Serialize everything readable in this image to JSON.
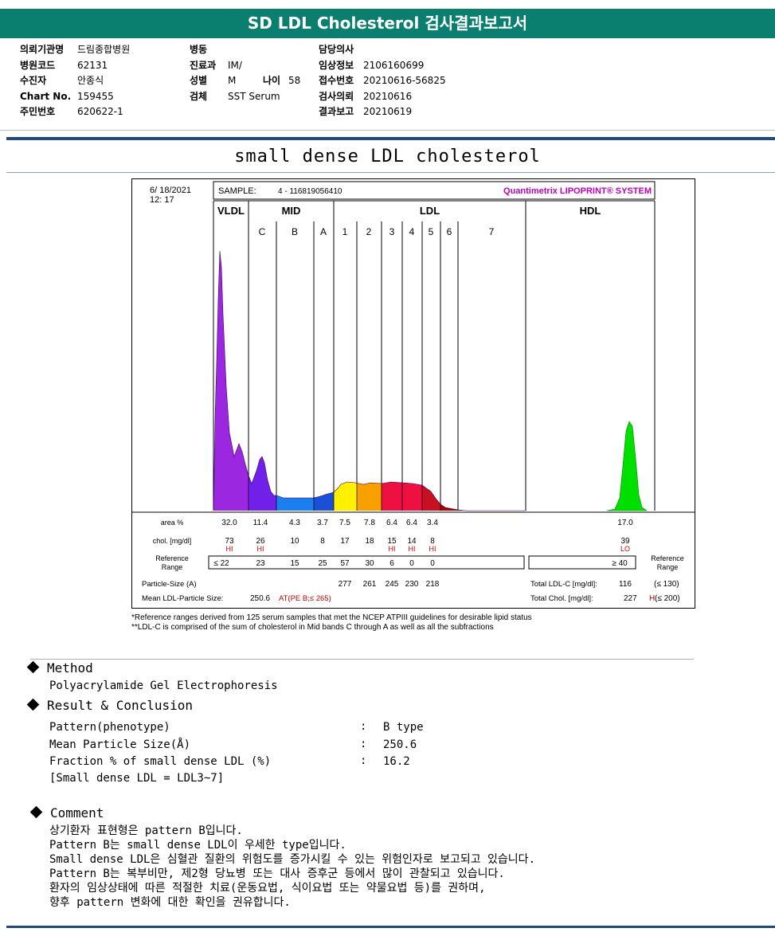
{
  "header": {
    "title": "SD LDL Cholesterol 검사결과보고서"
  },
  "patient_info": {
    "col1": [
      {
        "label": "의뢰기관명",
        "value": "드림종합병원"
      },
      {
        "label": "병원코드",
        "value": "62131"
      },
      {
        "label": "수진자",
        "value": "안종식"
      },
      {
        "label": "Chart No.",
        "value": "159455"
      },
      {
        "label": "주민번호",
        "value": "620622-1"
      }
    ],
    "col2": [
      {
        "label": "병동",
        "value": ""
      },
      {
        "label": "진료과",
        "value": "IM/"
      },
      {
        "label": "성별",
        "value": "M"
      },
      {
        "label": "검체",
        "value": "SST Serum"
      }
    ],
    "age_label": "나이",
    "age_value": "58",
    "col3": [
      {
        "label": "담당의사",
        "value": ""
      },
      {
        "label": "임상정보",
        "value": "2106160699"
      },
      {
        "label": "접수번호",
        "value": "20210616-56825"
      },
      {
        "label": "검사의뢰",
        "value": "20210616"
      },
      {
        "label": "결과보고",
        "value": "20210619"
      }
    ]
  },
  "report_title": "small dense LDL cholesterol",
  "chart_data": {
    "type": "area",
    "date": "6/ 18/2021",
    "time": "12: 17",
    "sample_label": "SAMPLE:",
    "sample_value": "4 - 116819056410",
    "brand": "Quantimetrix LIPOPRINT® SYSTEM",
    "group_labels": [
      "VLDL",
      "MID",
      "LDL",
      "HDL"
    ],
    "band_labels": [
      "C",
      "B",
      "A",
      "1",
      "2",
      "3",
      "4",
      "5",
      "6",
      "7"
    ],
    "band_colors": [
      "#9c27e0",
      "#7020e8",
      "#1c7ff0",
      "#1a50d8",
      "#fff000",
      "#f7a000",
      "#ee1040",
      "#ee1040",
      "#c81020",
      "#b00000",
      "#00e000"
    ],
    "rows": {
      "area_label": "area %",
      "area": [
        "32.0",
        "11.4",
        "4.3",
        "3.7",
        "7.5",
        "7.8",
        "6.4",
        "6.4",
        "3.4",
        "",
        "",
        "17.0"
      ],
      "chol_label": "chol. [mg/dl]",
      "chol": [
        "73",
        "26",
        "10",
        "8",
        "17",
        "18",
        "15",
        "14",
        "8",
        "",
        "",
        "39"
      ],
      "flags": [
        "HI",
        "HI",
        "",
        "",
        "",
        "",
        "HI",
        "HI",
        "HI",
        "",
        "",
        "LO"
      ],
      "ref_label_1": "Reference",
      "ref_label_2": "Range",
      "ref": [
        "≤ 22",
        "23",
        "15",
        "25",
        "57",
        "30",
        "6",
        "0",
        "0",
        "",
        "",
        "≥ 40"
      ],
      "particle_label": "Particle-Size (A)",
      "particle": [
        "277",
        "261",
        "245",
        "230",
        "218"
      ],
      "mean_label": "Mean LDL-Particle Size:",
      "mean_value": "250.6",
      "mean_flag": "AT(PE B;≤ 265)",
      "total_ldl_label": "Total LDL-C [mg/dl]:",
      "total_ldl_value": "116",
      "total_ldl_ref": "(≤ 130)",
      "total_chol_label": "Total Chol. [mg/dl]:",
      "total_chol_value": "227",
      "total_chol_flag": "H",
      "total_chol_ref": "(≤ 200)"
    }
  },
  "footnotes": [
    "*Reference ranges derived from 125 serum samples that met the NCEP ATPIII guidelines for desirable lipid status",
    "**LDL-C is comprised of the sum of cholesterol in Mid bands C through A as well as all the subfractions"
  ],
  "method": {
    "heading": "Method",
    "text": "Polyacrylamide Gel Electrophoresis"
  },
  "result": {
    "heading": "Result & Conclusion",
    "items": [
      {
        "label": "Pattern(phenotype)",
        "value": "B type"
      },
      {
        "label": "Mean Particle Size(Å)",
        "value": "250.6"
      },
      {
        "label": "Fraction % of small dense LDL (%)",
        "value": "16.2"
      }
    ],
    "note": "[Small dense LDL = LDL3~7]"
  },
  "comment": {
    "heading": "Comment",
    "lines": [
      "상기환자 표현형은 pattern B입니다.",
      "Pattern B는 small dense LDL이 우세한 type입니다.",
      "Small dense LDL은 심혈관 질환의 위험도를 증가시킬 수 있는 위험인자로 보고되고 있습니다.",
      "Pattern B는 복부비만, 제2형 당뇨병 또는 대사 증후군 등에서 많이 관찰되고 있습니다.",
      "환자의 임상상태에 따른 적절한 치료(운동요법, 식이요법 또는 약물요법 등)를 권하며,",
      "향후 pattern 변화에 대한 확인을 권유합니다."
    ]
  }
}
